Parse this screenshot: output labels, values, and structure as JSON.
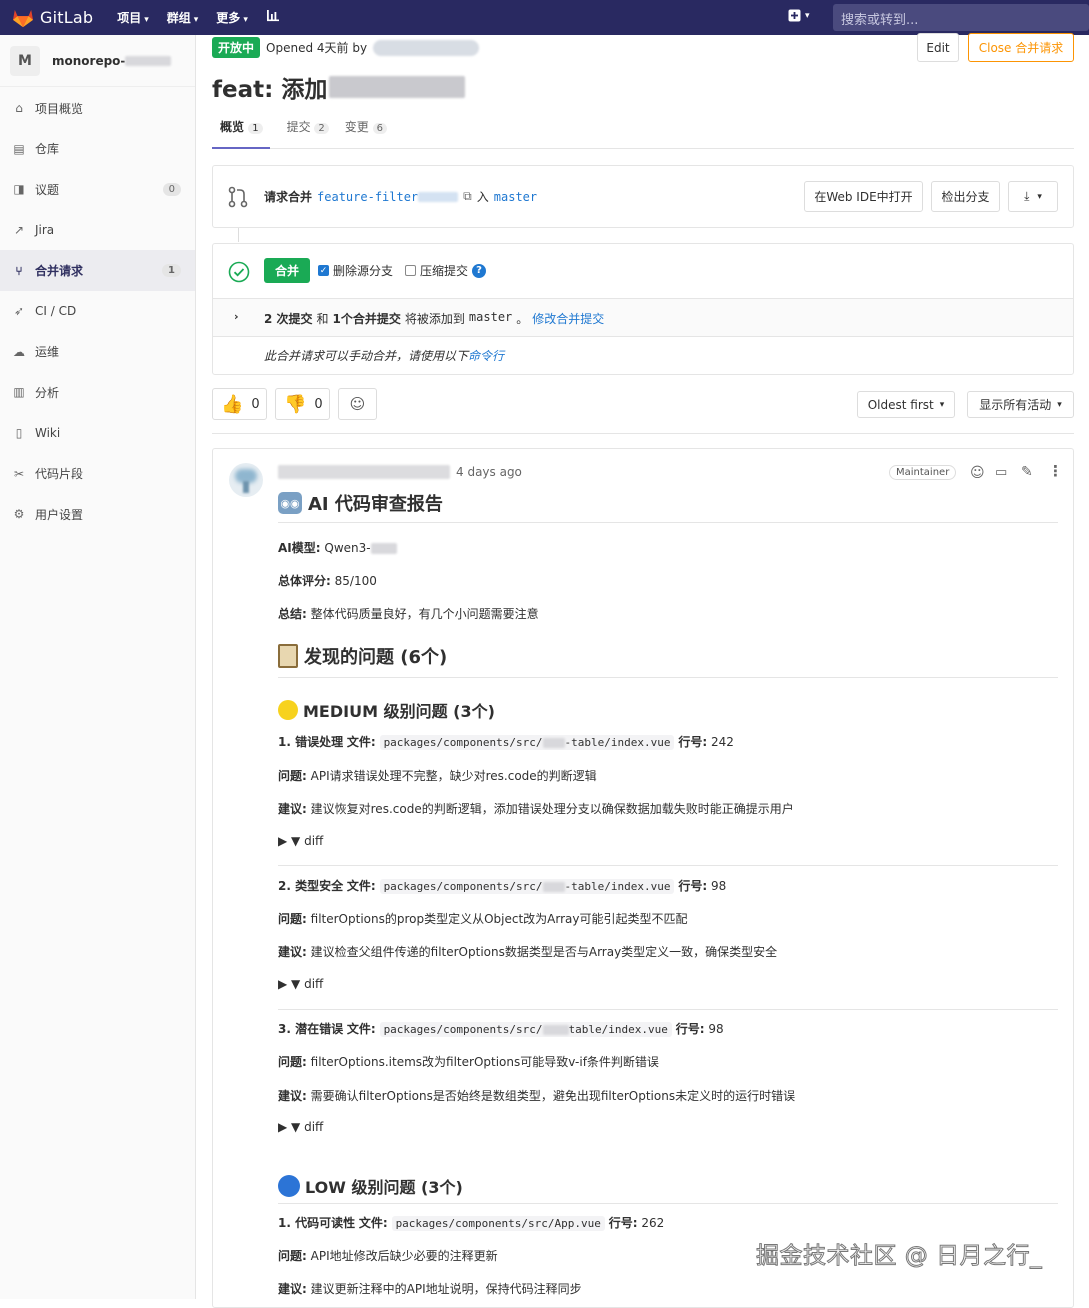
{
  "nav": {
    "brand": "GitLab",
    "menus": [
      "项目",
      "群组",
      "更多"
    ],
    "search_placeholder": "搜索或转到..."
  },
  "sidebar": {
    "project_initial": "M",
    "project_name": "monorepo-",
    "items": [
      {
        "label": "项目概览",
        "icon": "home-icon"
      },
      {
        "label": "仓库",
        "icon": "doc-icon"
      },
      {
        "label": "议题",
        "icon": "issues-icon",
        "count": "0"
      },
      {
        "label": "Jira",
        "icon": "external-link-icon"
      },
      {
        "label": "合并请求",
        "icon": "merge-request-icon",
        "count": "1",
        "active": true
      },
      {
        "label": "CI / CD",
        "icon": "rocket-icon"
      },
      {
        "label": "运维",
        "icon": "cloud-icon"
      },
      {
        "label": "分析",
        "icon": "chart-icon"
      },
      {
        "label": "Wiki",
        "icon": "book-icon"
      },
      {
        "label": "代码片段",
        "icon": "snippet-icon"
      },
      {
        "label": "用户设置",
        "icon": "gear-icon"
      }
    ]
  },
  "mr": {
    "status": "开放中",
    "opened_text": "Opened 4天前 by",
    "edit_label": "Edit",
    "close_label": "Close 合并请求",
    "title": "feat: 添加",
    "tabs": [
      {
        "label": "概览",
        "count": "1"
      },
      {
        "label": "提交",
        "count": "2"
      },
      {
        "label": "变更",
        "count": "6"
      }
    ],
    "branch": {
      "request_label": "请求合并",
      "source": "feature-filter",
      "into": "入",
      "target": "master",
      "web_ide": "在Web IDE中打开",
      "checkout": "检出分支"
    },
    "merge": {
      "merge_button": "合并",
      "delete_source": "删除源分支",
      "squash": "压缩提交",
      "summary_bold1": "2 次提交",
      "summary_mid": "和",
      "summary_bold2": "1个合并提交",
      "summary_tail": "将被添加到",
      "summary_target": "master",
      "summary_end": "。",
      "modify_link": "修改合并提交",
      "manual_text": "此合并请求可以手动合并，请使用以下",
      "manual_link": "命令行"
    },
    "reactions": {
      "thumbs_up": "0",
      "thumbs_down": "0"
    },
    "sort_label": "Oldest first",
    "filter_label": "显示所有活动"
  },
  "comment": {
    "time": "4 days ago",
    "role": "Maintainer",
    "report_title": "AI 代码审查报告",
    "model_label": "AI模型:",
    "model_value": "Qwen3-",
    "score_label": "总体评分:",
    "score_value": "85/100",
    "summary_label": "总结:",
    "summary_value": "整体代码质量良好，有几个小问题需要注意",
    "issues_title": "发现的问题 (6个)",
    "medium_title": "MEDIUM 级别问题 (3个)",
    "low_title": "LOW 级别问题 (3个)",
    "diff_label": "▶ ▼ diff",
    "problem_label": "问题:",
    "suggest_label": "建议:",
    "file_label": "文件:",
    "line_label": "行号:",
    "medium_issues": [
      {
        "head": "1. 错误处理",
        "file_a": "packages/components/src/",
        "file_b": "-table/index.vue",
        "line": "242",
        "problem": "API请求错误处理不完整，缺少对res.code的判断逻辑",
        "suggest": "建议恢复对res.code的判断逻辑，添加错误处理分支以确保数据加载失败时能正确提示用户"
      },
      {
        "head": "2. 类型安全",
        "file_a": "packages/components/src/",
        "file_b": "-table/index.vue",
        "line": "98",
        "problem": "filterOptions的prop类型定义从Object改为Array可能引起类型不匹配",
        "suggest": "建议检查父组件传递的filterOptions数据类型是否与Array类型定义一致，确保类型安全"
      },
      {
        "head": "3. 潜在错误",
        "file_a": "packages/components/src/",
        "file_b": "table/index.vue",
        "line": "98",
        "problem": "filterOptions.items改为filterOptions可能导致v-if条件判断错误",
        "suggest": "需要确认filterOptions是否始终是数组类型，避免出现filterOptions未定义时的运行时错误"
      }
    ],
    "low_issue": {
      "head": "1. 代码可读性",
      "file": "packages/components/src/App.vue",
      "line": "262",
      "problem": "API地址修改后缺少必要的注释更新",
      "suggest": "建议更新注释中的API地址说明，保持代码注释同步"
    }
  },
  "watermark": "掘金技术社区 @ 日月之行_",
  "colors": {
    "nav": "#292961",
    "open": "#1aaa55",
    "warn": "#fc9403",
    "link": "#1f78d1"
  }
}
